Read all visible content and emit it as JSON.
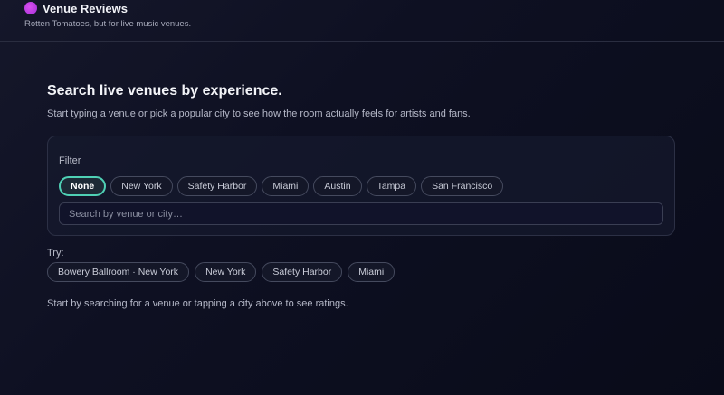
{
  "header": {
    "title": "Venue Reviews",
    "subtitle": "Rotten Tomatoes, but for live music venues."
  },
  "main": {
    "heading": "Search live venues by experience.",
    "lead": "Start typing a venue or pick a popular city to see how the room actually feels for artists and fans.",
    "filter": {
      "label": "Filter",
      "chips": [
        "None",
        "New York",
        "Safety Harbor",
        "Miami",
        "Austin",
        "Tampa",
        "San Francisco"
      ],
      "selected": "None"
    },
    "search": {
      "placeholder": "Search by venue or city…",
      "value": ""
    },
    "try": {
      "label": "Try:",
      "chips": [
        "Bowery Ballroom · New York",
        "New York",
        "Safety Harbor",
        "Miami"
      ]
    },
    "hint": "Start by searching for a venue or tapping a city above to see ratings."
  },
  "colors": {
    "accent": "#4fd1b5",
    "logo": "#c040e8"
  }
}
